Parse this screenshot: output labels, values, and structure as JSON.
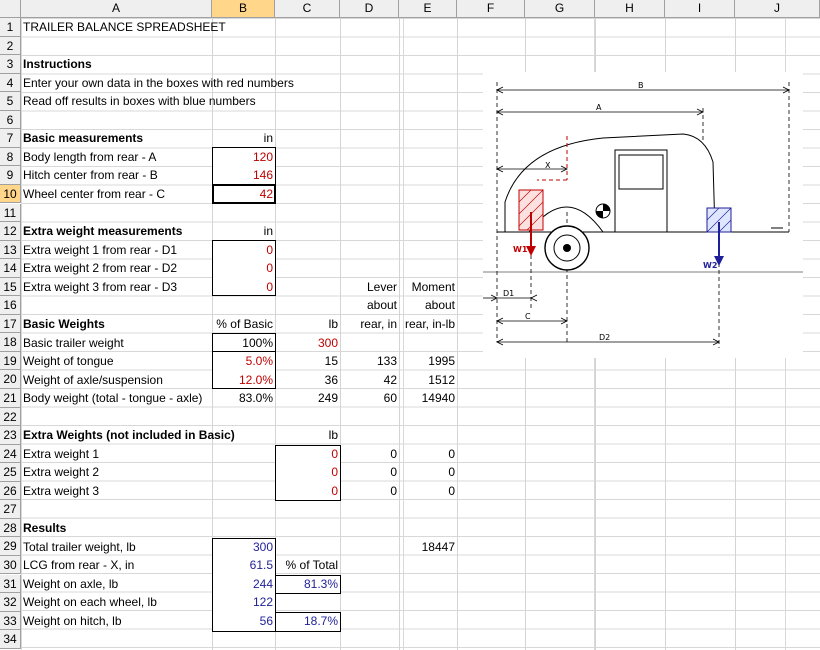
{
  "columns": [
    "A",
    "B",
    "C",
    "D",
    "E",
    "F",
    "G",
    "H",
    "I",
    "J"
  ],
  "rows": [
    "1",
    "2",
    "3",
    "4",
    "5",
    "6",
    "7",
    "8",
    "9",
    "10",
    "11",
    "12",
    "13",
    "14",
    "15",
    "16",
    "17",
    "18",
    "19",
    "20",
    "21",
    "22",
    "23",
    "24",
    "25",
    "26",
    "27",
    "28",
    "29",
    "30",
    "31",
    "32",
    "33",
    "34"
  ],
  "title": "TRAILER BALANCE SPREADSHEET",
  "instructions": {
    "header": "Instructions",
    "line1": "Enter your own data in the boxes with red numbers",
    "line2": "Read off results in boxes with blue numbers"
  },
  "basic": {
    "header": "Basic measurements",
    "unit": "in",
    "body_label": "Body length from rear - A",
    "body_value": "120",
    "hitch_label": "Hitch center from rear - B",
    "hitch_value": "146",
    "wheel_label": "Wheel center from rear - C",
    "wheel_value": "42"
  },
  "extra_meas": {
    "header": "Extra weight measurements",
    "unit": "in",
    "d1_label": "Extra weight 1 from rear - D1",
    "d1_value": "0",
    "d2_label": "Extra weight 2 from rear - D2",
    "d2_value": "0",
    "d3_label": "Extra weight 3 from rear - D3",
    "d3_value": "0"
  },
  "headers": {
    "lever1": "Lever",
    "lever2": "about",
    "lever3": "rear, in",
    "moment1": "Moment",
    "moment2": "about",
    "moment3": "rear, in-lb"
  },
  "weights": {
    "header": "Basic Weights",
    "pct_header": "% of Basic",
    "lb_header": "lb",
    "basic_label": "Basic trailer weight",
    "basic_pct": "100%",
    "basic_lb": "300",
    "tongue_label": "Weight of tongue",
    "tongue_pct": "5.0%",
    "tongue_lb": "15",
    "tongue_lever": "133",
    "tongue_moment": "1995",
    "axle_label": "Weight of axle/suspension",
    "axle_pct": "12.0%",
    "axle_lb": "36",
    "axle_lever": "42",
    "axle_moment": "1512",
    "body_label": "Body weight (total - tongue - axle)",
    "body_pct": "83.0%",
    "body_lb": "249",
    "body_lever": "60",
    "body_moment": "14940"
  },
  "extra_weights": {
    "header": "Extra Weights (not included in Basic)",
    "lb_header": "lb",
    "w1_label": "Extra weight 1",
    "w1_lb": "0",
    "w1_lever": "0",
    "w1_moment": "0",
    "w2_label": "Extra weight 2",
    "w2_lb": "0",
    "w2_lever": "0",
    "w2_moment": "0",
    "w3_label": "Extra weight 3",
    "w3_lb": "0",
    "w3_lever": "0",
    "w3_moment": "0"
  },
  "results": {
    "header": "Results",
    "total_label": "Total trailer weight, lb",
    "total_value": "300",
    "total_moment": "18447",
    "lcg_label": "LCG from rear - X, in",
    "lcg_value": "61.5",
    "pct_total": "% of Total",
    "axle_label": "Weight on axle, lb",
    "axle_value": "244",
    "axle_pct": "81.3%",
    "wheel_label": "Weight on each wheel, lb",
    "wheel_value": "122",
    "hitch_label": "Weight on hitch, lb",
    "hitch_value": "56",
    "hitch_pct": "18.7%"
  },
  "diagram": {
    "label_b": "B",
    "label_a": "A",
    "label_x": "X",
    "label_c": "C",
    "label_d1": "D1",
    "label_d2": "D2",
    "label_w1": "W1",
    "label_w2": "W2"
  },
  "colors": {
    "red": "#c00000",
    "blue": "#1f1f99",
    "header_bg": "#efefef",
    "selected_header": "#ffd68a"
  }
}
